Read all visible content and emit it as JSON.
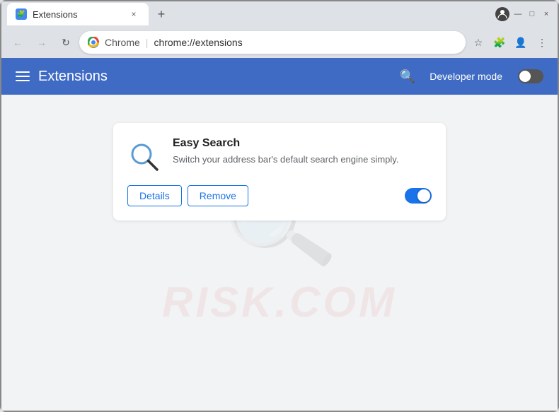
{
  "window": {
    "title_bar": {
      "tab_icon": "🧩",
      "tab_title": "Extensions",
      "tab_close": "×",
      "new_tab": "+",
      "profile_dropdown": "▾",
      "minimize": "—",
      "maximize": "□",
      "close": "×"
    },
    "nav_bar": {
      "back_arrow": "←",
      "forward_arrow": "→",
      "reload": "↻",
      "lock_icon": "🔒",
      "chrome_label": "Chrome",
      "address_divider": "|",
      "address_url": "chrome://extensions",
      "bookmark_icon": "☆",
      "extensions_icon": "🧩",
      "profile_icon": "👤",
      "menu_icon": "⋮"
    },
    "ext_header": {
      "menu_icon": "☰",
      "title": "Extensions",
      "search_icon": "🔍",
      "developer_mode_label": "Developer mode",
      "toggle_state": "off"
    },
    "main": {
      "watermark_text": "RISK.COM",
      "extension_card": {
        "name": "Easy Search",
        "description": "Switch your address bar's default search engine simply.",
        "details_btn": "Details",
        "remove_btn": "Remove",
        "toggle_state": "on"
      }
    }
  }
}
